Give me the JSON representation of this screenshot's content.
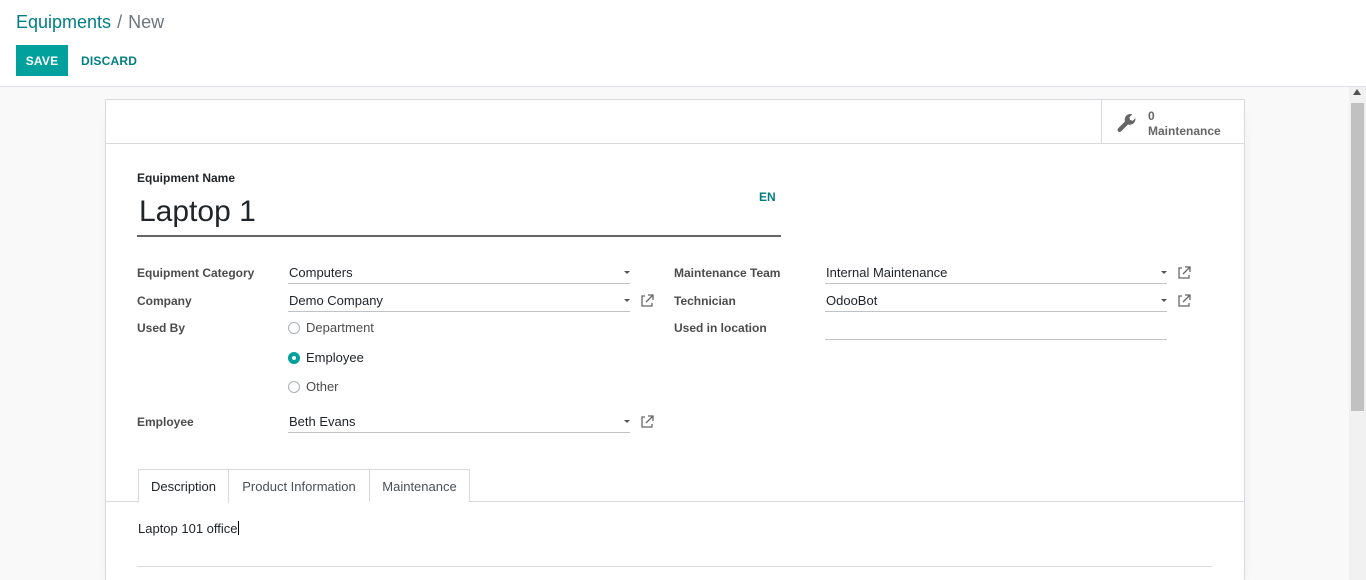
{
  "breadcrumb": {
    "parent": "Equipments",
    "separator": "/",
    "current": "New"
  },
  "toolbar": {
    "save_label": "SAVE",
    "discard_label": "DISCARD"
  },
  "stat_button": {
    "value": "0",
    "label": "Maintenance",
    "icon": "wrench-icon"
  },
  "form": {
    "title_label": "Equipment Name",
    "title_value": "Laptop 1",
    "lang_button": "EN",
    "left": {
      "category_label": "Equipment Category",
      "category_value": "Computers",
      "company_label": "Company",
      "company_value": "Demo Company",
      "used_by_label": "Used By",
      "used_by_options": [
        "Department",
        "Employee",
        "Other"
      ],
      "used_by_selected": "Employee",
      "employee_label": "Employee",
      "employee_value": "Beth Evans"
    },
    "right": {
      "team_label": "Maintenance Team",
      "team_value": "Internal Maintenance",
      "technician_label": "Technician",
      "technician_value": "OdooBot",
      "location_label": "Used in location",
      "location_value": ""
    }
  },
  "tabs": [
    {
      "label": "Description",
      "active": true
    },
    {
      "label": "Product Information",
      "active": false
    },
    {
      "label": "Maintenance",
      "active": false
    }
  ],
  "description_value": "Laptop 101 office",
  "colors": {
    "primary": "#00a09d",
    "link": "#017e84",
    "muted": "#6c757d"
  }
}
